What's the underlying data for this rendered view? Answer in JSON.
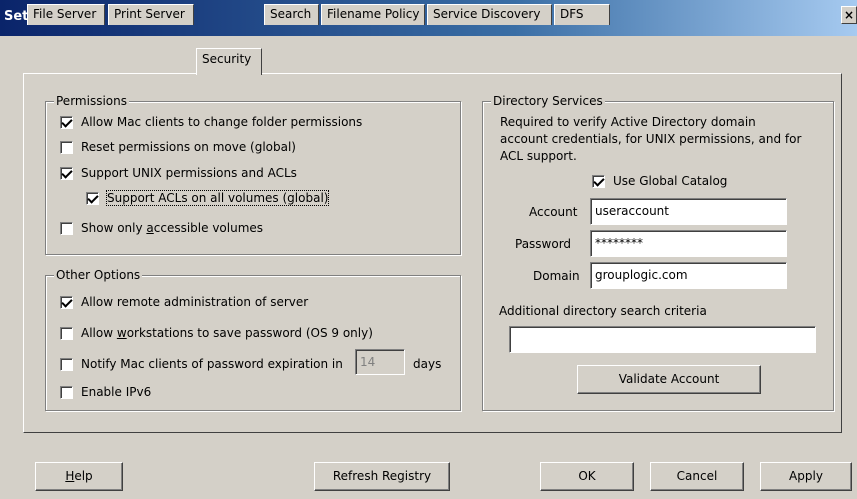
{
  "window": {
    "title": "Settings",
    "close_glyph": "×"
  },
  "tabs": [
    {
      "label": "File Server"
    },
    {
      "label": "Print Server"
    },
    {
      "label": "Security",
      "active": true
    },
    {
      "label": "Search"
    },
    {
      "label": "Filename Policy"
    },
    {
      "label": "Service Discovery"
    },
    {
      "label": "DFS"
    }
  ],
  "permissions": {
    "legend": "Permissions",
    "allow_mac_change": {
      "label": "Allow Mac clients to change folder permissions",
      "checked": true
    },
    "reset_on_move": {
      "label": "Reset permissions on move (global)",
      "checked": false
    },
    "support_unix": {
      "label": "Support UNIX permissions and ACLs",
      "checked": true
    },
    "support_acls": {
      "label": "Support ACLs on all volumes (global)",
      "checked": true
    },
    "show_accessible": {
      "pre": "Show only ",
      "accel": "a",
      "post": "ccessible volumes",
      "checked": false
    }
  },
  "other_options": {
    "legend": "Other Options",
    "remote_admin": {
      "label": "Allow remote administration of server",
      "checked": true
    },
    "save_password": {
      "pre": "Allow ",
      "accel": "w",
      "post": "orkstations to save password (OS 9 only)",
      "checked": false
    },
    "notify_expiration": {
      "label": "Notify Mac clients of password expiration in",
      "checked": false,
      "days_value": "14",
      "days_label": "days"
    },
    "ipv6": {
      "label": "Enable IPv6",
      "checked": false
    }
  },
  "directory_services": {
    "legend": "Directory Services",
    "description_line1": "Required to verify Active Directory domain",
    "description_line2": "account credentials, for UNIX permissions, and for",
    "description_line3": "ACL support.",
    "use_global_catalog": {
      "label": "Use Global Catalog",
      "checked": true
    },
    "account_label": "Account",
    "account_value": "useraccount",
    "password_label": "Password",
    "password_value": "********",
    "domain_label": "Domain",
    "domain_value": "grouplogic.com",
    "search_criteria_label": "Additional directory search criteria",
    "search_criteria_value": "",
    "validate_button": "Validate Account"
  },
  "footer": {
    "help_accel": "H",
    "help_rest": "elp",
    "refresh_button": "Refresh Registry",
    "ok_button": "OK",
    "cancel_button": "Cancel",
    "apply_button": "Apply"
  }
}
